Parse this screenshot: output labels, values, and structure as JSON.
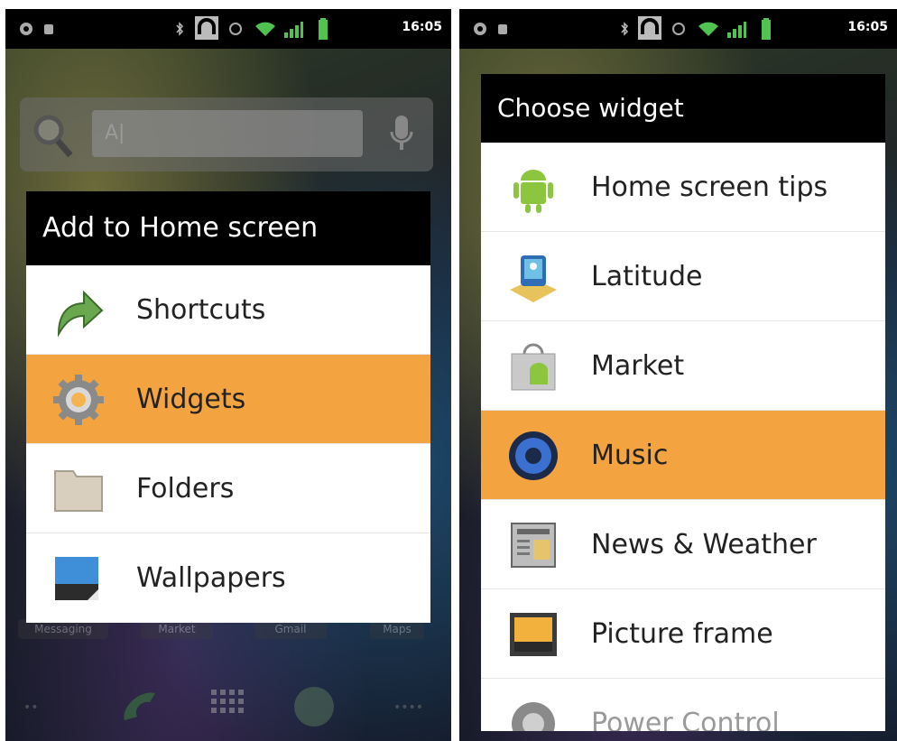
{
  "left": {
    "status": {
      "time": "16:05"
    },
    "search": {
      "placeholder": "A|"
    },
    "dialog": {
      "title": "Add to Home screen",
      "items": [
        {
          "label": "Shortcuts",
          "icon": "shortcut-arrow-icon",
          "selected": false
        },
        {
          "label": "Widgets",
          "icon": "gear-icon",
          "selected": true
        },
        {
          "label": "Folders",
          "icon": "folder-icon",
          "selected": false
        },
        {
          "label": "Wallpapers",
          "icon": "wallpaper-icon",
          "selected": false
        }
      ]
    },
    "dock": {
      "labels": [
        "Messaging",
        "Market",
        "Gmail",
        "Maps"
      ]
    }
  },
  "right": {
    "status": {
      "time": "16:05"
    },
    "dialog": {
      "title": "Choose widget",
      "items": [
        {
          "label": "Home screen tips",
          "icon": "android-icon",
          "selected": false
        },
        {
          "label": "Latitude",
          "icon": "latitude-icon",
          "selected": false
        },
        {
          "label": "Market",
          "icon": "market-bag-icon",
          "selected": false
        },
        {
          "label": "Music",
          "icon": "speaker-icon",
          "selected": true
        },
        {
          "label": "News & Weather",
          "icon": "newspaper-icon",
          "selected": false
        },
        {
          "label": "Picture frame",
          "icon": "picture-frame-icon",
          "selected": false
        },
        {
          "label": "Power Control",
          "icon": "power-control-icon",
          "selected": false
        }
      ]
    }
  },
  "colors": {
    "selected": "#f3a440",
    "title_bar": "#000000",
    "list_bg": "#ffffff"
  }
}
